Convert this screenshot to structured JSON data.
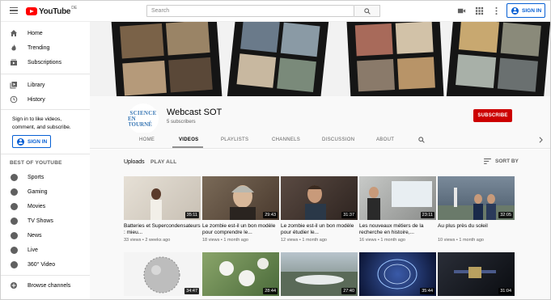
{
  "header": {
    "logo_word": "YouTube",
    "logo_region": "DE",
    "search_placeholder": "Search",
    "signin_label": "SIGN IN"
  },
  "sidebar": {
    "main": [
      {
        "label": "Home",
        "icon": "home-icon"
      },
      {
        "label": "Trending",
        "icon": "flame-icon"
      },
      {
        "label": "Subscriptions",
        "icon": "subscriptions-icon"
      }
    ],
    "library": [
      {
        "label": "Library",
        "icon": "library-icon"
      },
      {
        "label": "History",
        "icon": "history-icon"
      }
    ],
    "signin_note": "Sign in to like videos, comment, and subscribe.",
    "signin_label": "SIGN IN",
    "best_heading": "BEST OF YOUTUBE",
    "best": [
      {
        "label": "Sports"
      },
      {
        "label": "Gaming"
      },
      {
        "label": "Movies"
      },
      {
        "label": "TV Shows"
      },
      {
        "label": "News"
      },
      {
        "label": "Live"
      },
      {
        "label": "360° Video"
      }
    ],
    "browse": "Browse channels"
  },
  "channel": {
    "logo_line1": "SCIENCE",
    "logo_line2": "EN TOURNÉ",
    "name": "Webcast SOT",
    "subscribers": "5 subscribers",
    "subscribe_label": "SUBSCRIBE"
  },
  "tabs": [
    {
      "label": "HOME"
    },
    {
      "label": "VIDEOS"
    },
    {
      "label": "PLAYLISTS"
    },
    {
      "label": "CHANNELS"
    },
    {
      "label": "DISCUSSION"
    },
    {
      "label": "ABOUT"
    }
  ],
  "section": {
    "title": "Uploads",
    "play_all": "PLAY ALL",
    "sort_by": "SORT BY"
  },
  "videos": [
    {
      "title": "Batteries et Supercondensateurs : mieu...",
      "views": "33 views",
      "age": "2 weeks ago",
      "duration": "35:11",
      "color": "#d8d2c8"
    },
    {
      "title": "Le zombie est-il un bon modèle pour comprendre le...",
      "views": "18 views",
      "age": "1 month ago",
      "duration": "29:43",
      "color": "#6b5a4a"
    },
    {
      "title": "Le zombie est-il un bon modèle pour étudier le...",
      "views": "12 views",
      "age": "1 month ago",
      "duration": "31:37",
      "color": "#4a3a33"
    },
    {
      "title": "Les nouveaux métiers de la recherche en histoire,...",
      "views": "16 views",
      "age": "1 month ago",
      "duration": "23:11",
      "color": "#a8aaa8"
    },
    {
      "title": "Au plus près du soleil",
      "views": "10 views",
      "age": "1 month ago",
      "duration": "32:05",
      "color": "#5a6a7a"
    },
    {
      "title": "",
      "views": "",
      "age": "",
      "duration": "34:47",
      "color": "#cfcfcf"
    },
    {
      "title": "",
      "views": "",
      "age": "",
      "duration": "28:44",
      "color": "#6f8a55"
    },
    {
      "title": "",
      "views": "",
      "age": "",
      "duration": "27:40",
      "color": "#8a9298"
    },
    {
      "title": "",
      "views": "",
      "age": "",
      "duration": "35:44",
      "color": "#1b2a55"
    },
    {
      "title": "",
      "views": "",
      "age": "",
      "duration": "31:04",
      "color": "#1a1e24"
    }
  ]
}
